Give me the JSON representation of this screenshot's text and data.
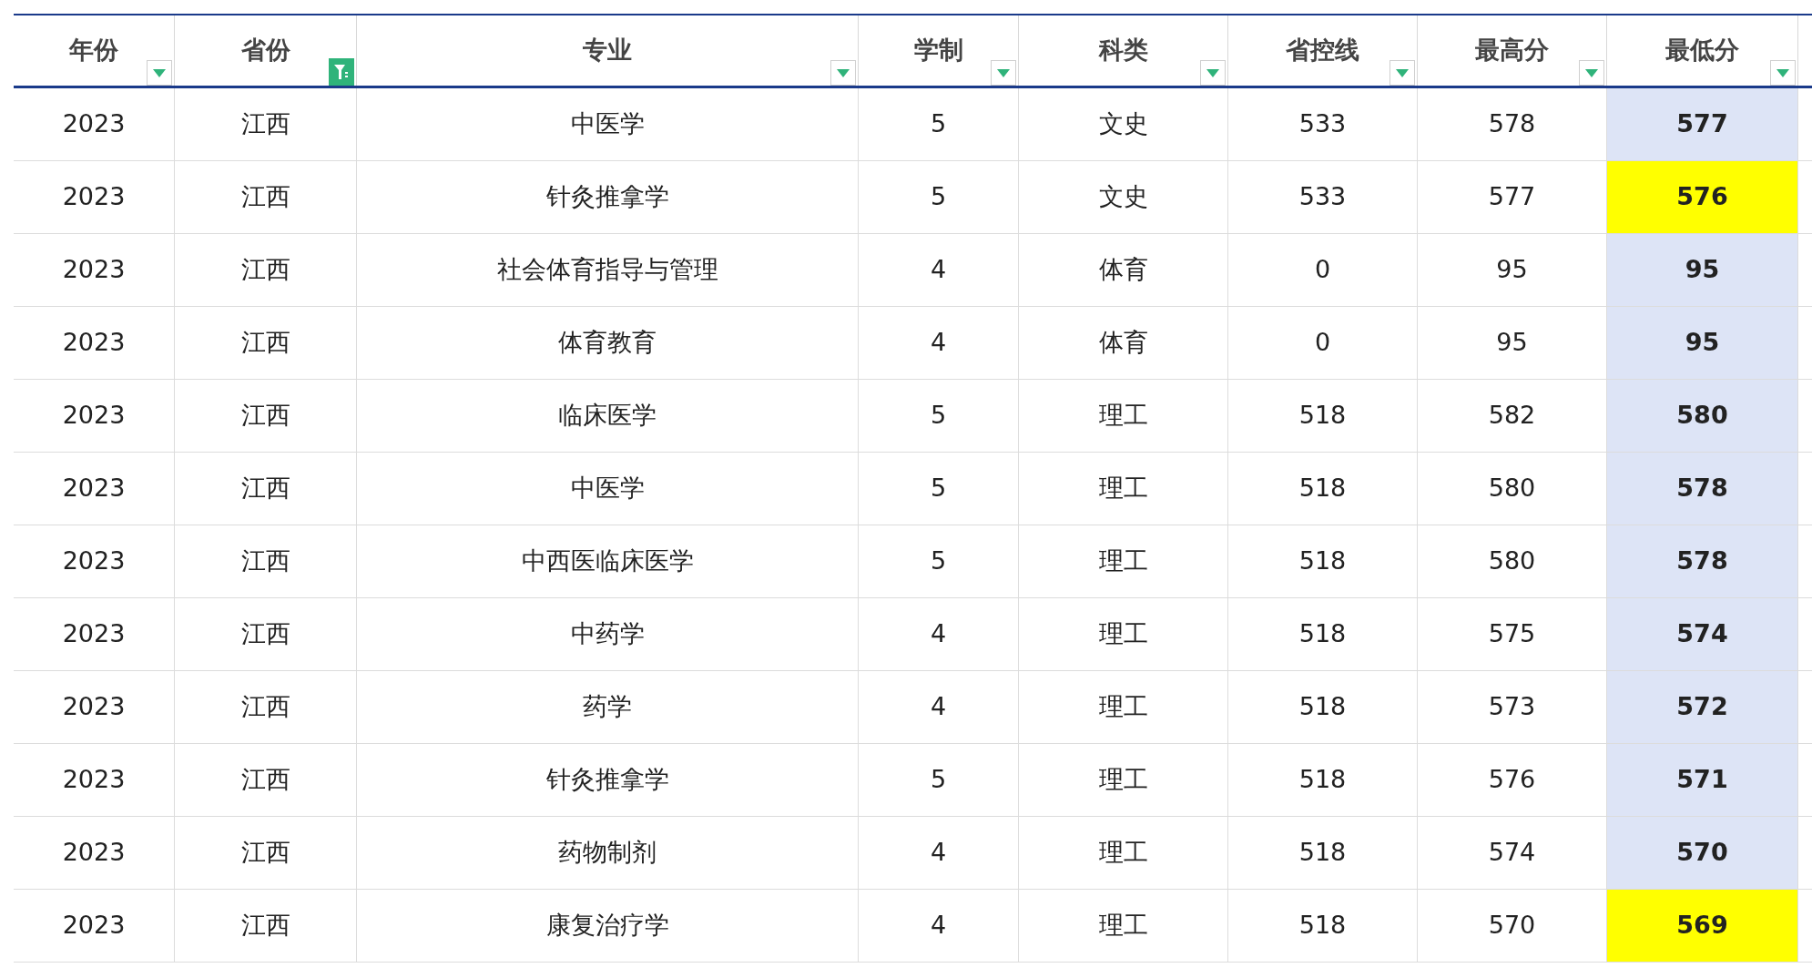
{
  "columns": [
    {
      "label": "年份",
      "filtered": false
    },
    {
      "label": "省份",
      "filtered": true
    },
    {
      "label": "专业",
      "filtered": false
    },
    {
      "label": "学制",
      "filtered": false
    },
    {
      "label": "科类",
      "filtered": false
    },
    {
      "label": "省控线",
      "filtered": false
    },
    {
      "label": "最高分",
      "filtered": false
    },
    {
      "label": "最低分",
      "filtered": false
    }
  ],
  "rows": [
    {
      "cells": [
        "2023",
        "江西",
        "中医学",
        "5",
        "文史",
        "533",
        "578",
        "577"
      ],
      "highlighted": false
    },
    {
      "cells": [
        "2023",
        "江西",
        "针灸推拿学",
        "5",
        "文史",
        "533",
        "577",
        "576"
      ],
      "highlighted": true
    },
    {
      "cells": [
        "2023",
        "江西",
        "社会体育指导与管理",
        "4",
        "体育",
        "0",
        "95",
        "95"
      ],
      "highlighted": false
    },
    {
      "cells": [
        "2023",
        "江西",
        "体育教育",
        "4",
        "体育",
        "0",
        "95",
        "95"
      ],
      "highlighted": false
    },
    {
      "cells": [
        "2023",
        "江西",
        "临床医学",
        "5",
        "理工",
        "518",
        "582",
        "580"
      ],
      "highlighted": false
    },
    {
      "cells": [
        "2023",
        "江西",
        "中医学",
        "5",
        "理工",
        "518",
        "580",
        "578"
      ],
      "highlighted": false
    },
    {
      "cells": [
        "2023",
        "江西",
        "中西医临床医学",
        "5",
        "理工",
        "518",
        "580",
        "578"
      ],
      "highlighted": false
    },
    {
      "cells": [
        "2023",
        "江西",
        "中药学",
        "4",
        "理工",
        "518",
        "575",
        "574"
      ],
      "highlighted": false
    },
    {
      "cells": [
        "2023",
        "江西",
        "药学",
        "4",
        "理工",
        "518",
        "573",
        "572"
      ],
      "highlighted": false
    },
    {
      "cells": [
        "2023",
        "江西",
        "针灸推拿学",
        "5",
        "理工",
        "518",
        "576",
        "571"
      ],
      "highlighted": false
    },
    {
      "cells": [
        "2023",
        "江西",
        "药物制剂",
        "4",
        "理工",
        "518",
        "574",
        "570"
      ],
      "highlighted": false
    },
    {
      "cells": [
        "2023",
        "江西",
        "康复治疗学",
        "4",
        "理工",
        "518",
        "570",
        "569"
      ],
      "highlighted": true
    }
  ]
}
